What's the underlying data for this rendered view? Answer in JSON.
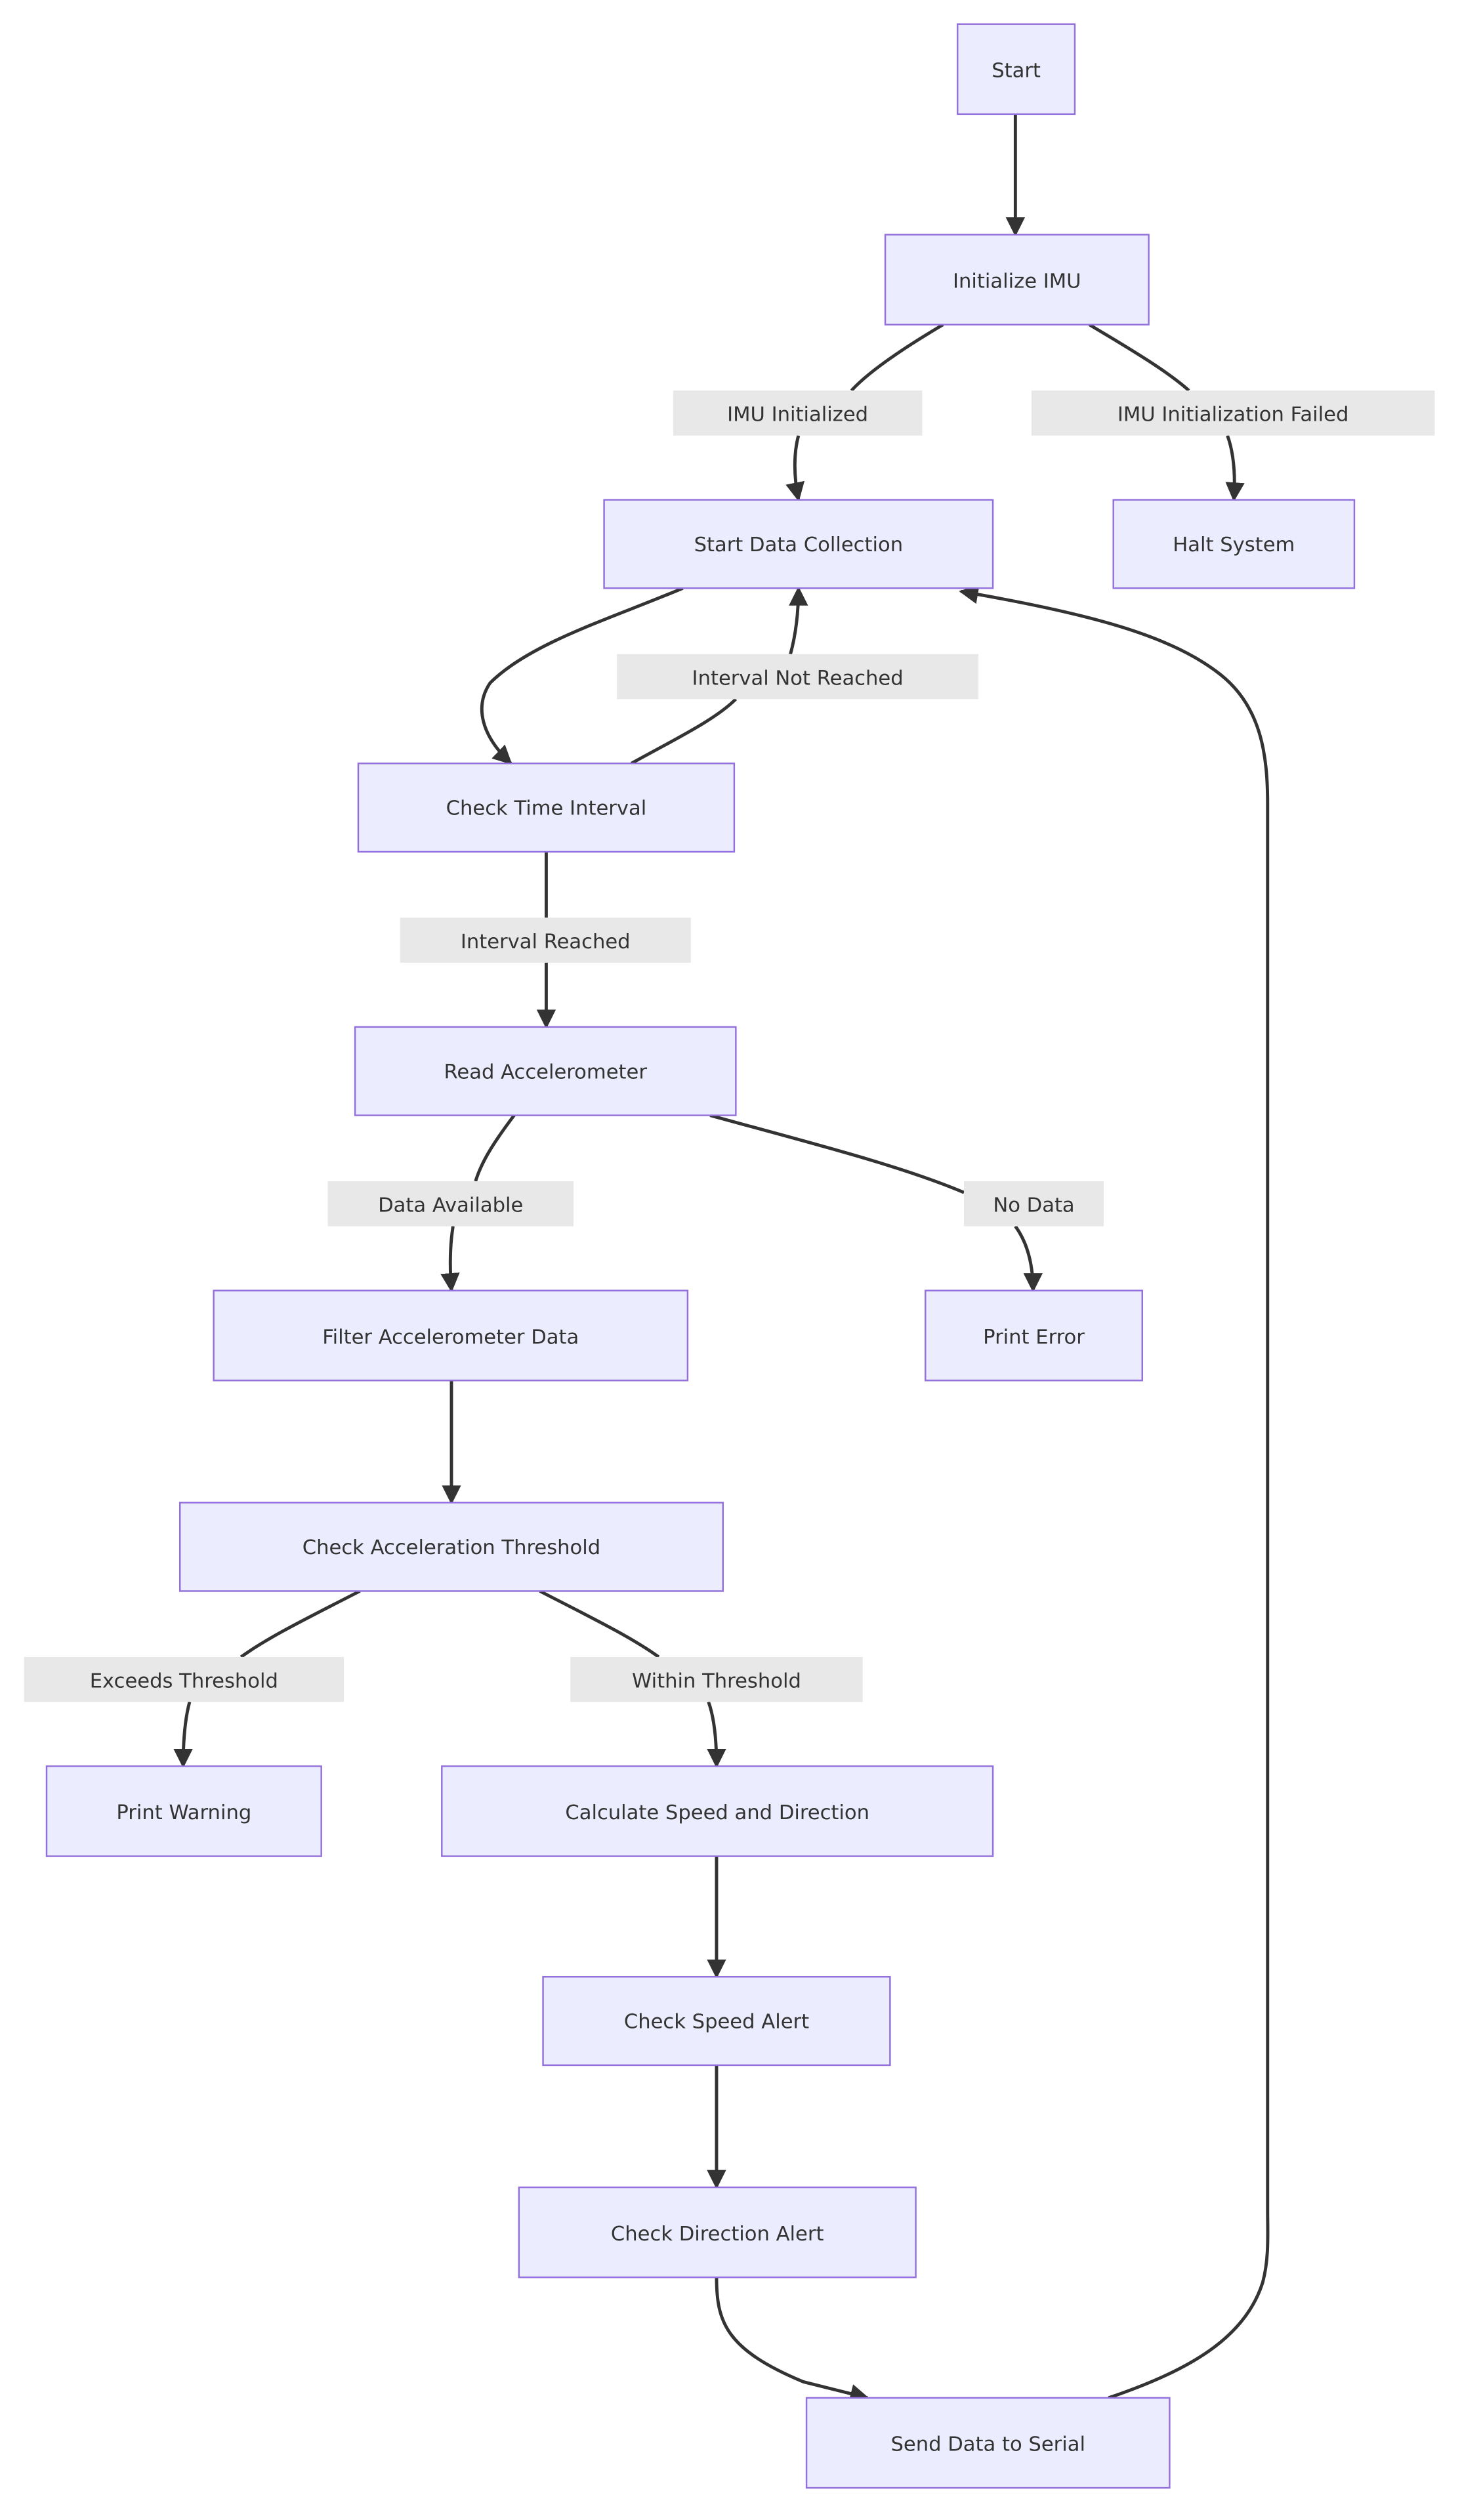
{
  "diagram": {
    "type": "flowchart",
    "direction": "top-down",
    "colors": {
      "node_fill": "#ECECFF",
      "node_stroke": "#9370DB",
      "text": "#333333",
      "edge": "#333333",
      "edge_label_bg": "#E8E8E8",
      "background": "#FFFFFF"
    },
    "nodes": [
      {
        "id": "start",
        "label": "Start"
      },
      {
        "id": "init_imu",
        "label": "Initialize IMU"
      },
      {
        "id": "start_collection",
        "label": "Start Data Collection"
      },
      {
        "id": "halt",
        "label": "Halt System"
      },
      {
        "id": "check_interval",
        "label": "Check Time Interval"
      },
      {
        "id": "read_accel",
        "label": "Read Accelerometer"
      },
      {
        "id": "filter_accel",
        "label": "Filter Accelerometer Data"
      },
      {
        "id": "print_error",
        "label": "Print Error"
      },
      {
        "id": "check_threshold",
        "label": "Check Acceleration Threshold"
      },
      {
        "id": "print_warning",
        "label": "Print Warning"
      },
      {
        "id": "calc_speed",
        "label": "Calculate Speed and Direction"
      },
      {
        "id": "check_speed",
        "label": "Check Speed Alert"
      },
      {
        "id": "check_direction",
        "label": "Check Direction Alert"
      },
      {
        "id": "send_serial",
        "label": "Send Data to Serial"
      }
    ],
    "edges": [
      {
        "from": "start",
        "to": "init_imu",
        "label": ""
      },
      {
        "from": "init_imu",
        "to": "start_collection",
        "label": "IMU Initialized"
      },
      {
        "from": "init_imu",
        "to": "halt",
        "label": "IMU Initialization Failed"
      },
      {
        "from": "start_collection",
        "to": "check_interval",
        "label": ""
      },
      {
        "from": "check_interval",
        "to": "start_collection",
        "label": "Interval Not Reached"
      },
      {
        "from": "check_interval",
        "to": "read_accel",
        "label": "Interval Reached"
      },
      {
        "from": "read_accel",
        "to": "filter_accel",
        "label": "Data Available"
      },
      {
        "from": "read_accel",
        "to": "print_error",
        "label": "No Data"
      },
      {
        "from": "filter_accel",
        "to": "check_threshold",
        "label": ""
      },
      {
        "from": "check_threshold",
        "to": "print_warning",
        "label": "Exceeds Threshold"
      },
      {
        "from": "check_threshold",
        "to": "calc_speed",
        "label": "Within Threshold"
      },
      {
        "from": "calc_speed",
        "to": "check_speed",
        "label": ""
      },
      {
        "from": "check_speed",
        "to": "check_direction",
        "label": ""
      },
      {
        "from": "check_direction",
        "to": "send_serial",
        "label": ""
      },
      {
        "from": "send_serial",
        "to": "start_collection",
        "label": ""
      }
    ]
  }
}
